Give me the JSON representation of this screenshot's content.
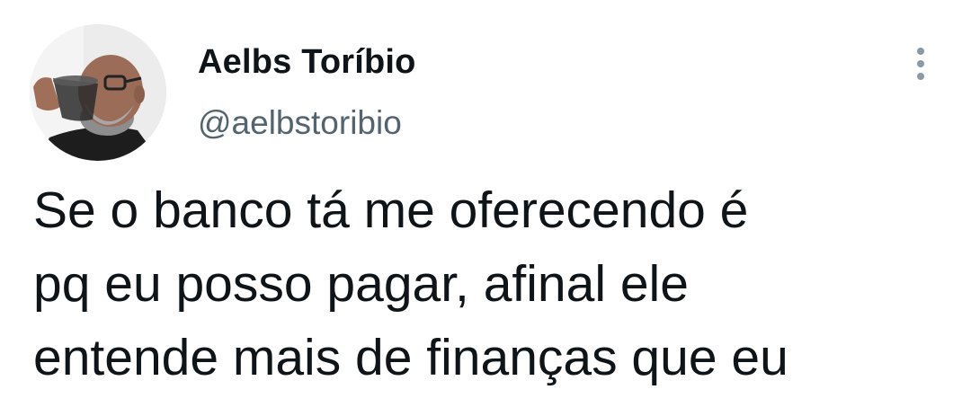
{
  "tweet": {
    "author": {
      "display_name": "Aelbs Toríbio",
      "handle": "@aelbstoribio",
      "avatar_icon": "profile-photo"
    },
    "more_icon": "more-vertical-icon",
    "text": "Se o banco tá me oferecendo é\npq eu posso pagar, afinal ele\nentende mais de finanças que eu"
  },
  "colors": {
    "text": "#0f1419",
    "secondary": "#536471",
    "icon": "#8b98a5",
    "background": "#ffffff"
  }
}
